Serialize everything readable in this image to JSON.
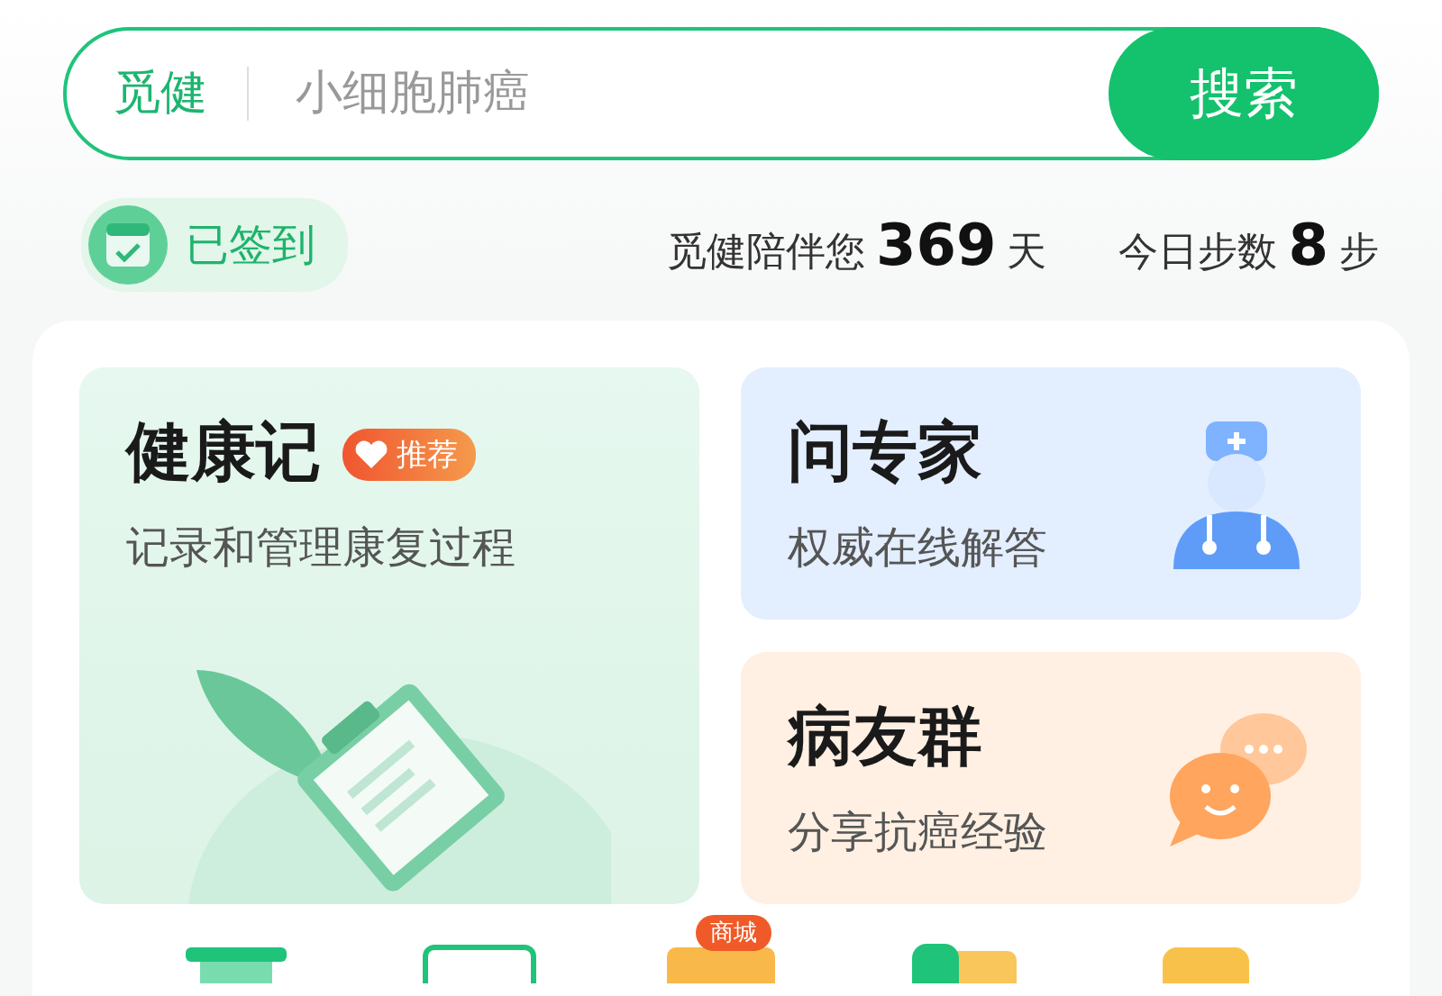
{
  "search": {
    "brand": "觅健",
    "placeholder": "小细胞肺癌",
    "button": "搜索"
  },
  "checkin": {
    "label": "已签到",
    "checked": true
  },
  "stats": [
    {
      "prefix": "觅健陪伴您",
      "value": "369",
      "unit": "天"
    },
    {
      "prefix": "今日步数",
      "value": "8",
      "unit": "步"
    }
  ],
  "cards": [
    {
      "kind": "record",
      "title": "健康记",
      "badge": "推荐",
      "subtitle": "记录和管理康复过程"
    },
    {
      "kind": "expert",
      "title": "问专家",
      "subtitle": "权威在线解答"
    },
    {
      "kind": "group",
      "title": "病友群",
      "subtitle": "分享抗癌经验"
    }
  ],
  "shortcuts": [
    {
      "kind": "green"
    },
    {
      "kind": "outline"
    },
    {
      "kind": "orange",
      "badge": "商城"
    },
    {
      "kind": "mixed"
    },
    {
      "kind": "yellow"
    }
  ]
}
